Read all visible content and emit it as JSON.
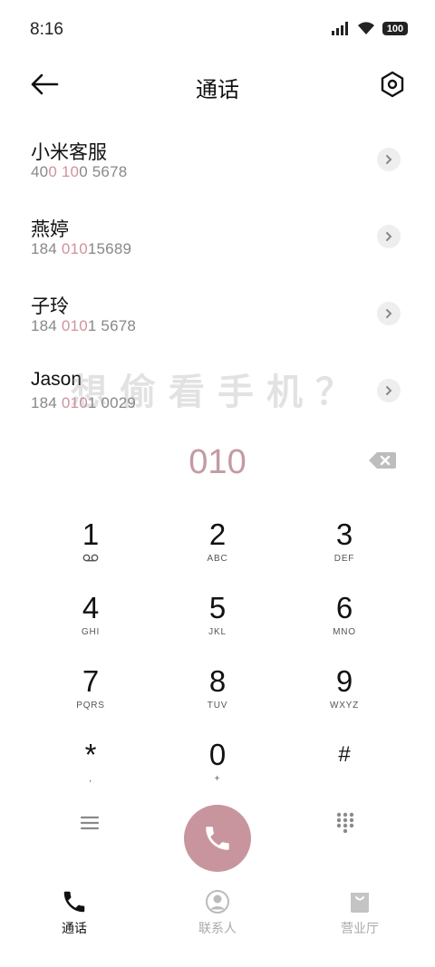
{
  "status": {
    "time": "8:16",
    "battery": "100"
  },
  "header": {
    "title": "通话"
  },
  "results": [
    {
      "name": "小米客服",
      "number_parts": [
        "40",
        "0 10",
        "0 5678"
      ]
    },
    {
      "name": "燕婷",
      "number_parts": [
        "184 ",
        "010",
        "15689"
      ]
    },
    {
      "name": "子玲",
      "number_parts": [
        "184 ",
        "010",
        "1 5678"
      ]
    },
    {
      "name": "Jason",
      "number_parts": [
        "184 ",
        "010",
        "1 0029"
      ]
    }
  ],
  "watermark": "想偷看手机？",
  "dial": {
    "number": "010"
  },
  "keypad": [
    {
      "digit": "1",
      "letters": ""
    },
    {
      "digit": "2",
      "letters": "ABC"
    },
    {
      "digit": "3",
      "letters": "DEF"
    },
    {
      "digit": "4",
      "letters": "GHI"
    },
    {
      "digit": "5",
      "letters": "JKL"
    },
    {
      "digit": "6",
      "letters": "MNO"
    },
    {
      "digit": "7",
      "letters": "PQRS"
    },
    {
      "digit": "8",
      "letters": "TUV"
    },
    {
      "digit": "9",
      "letters": "WXYZ"
    },
    {
      "digit": "*",
      "letters": ","
    },
    {
      "digit": "0",
      "letters": "+"
    },
    {
      "digit": "#",
      "letters": ""
    }
  ],
  "nav": {
    "calls": "通话",
    "contacts": "联系人",
    "business": "营业厅"
  },
  "colors": {
    "accent": "#c8959e",
    "highlight": "#d0929e",
    "dial_text": "#c39ba3"
  },
  "icons": {
    "back": "arrow-left-icon",
    "settings": "hexagon-settings-icon",
    "detail": "chevron-right-icon",
    "backspace": "backspace-icon",
    "voicemail": "voicemail-icon",
    "menu": "hamburger-menu-icon",
    "call": "phone-icon",
    "dialpad": "dialpad-icon"
  }
}
